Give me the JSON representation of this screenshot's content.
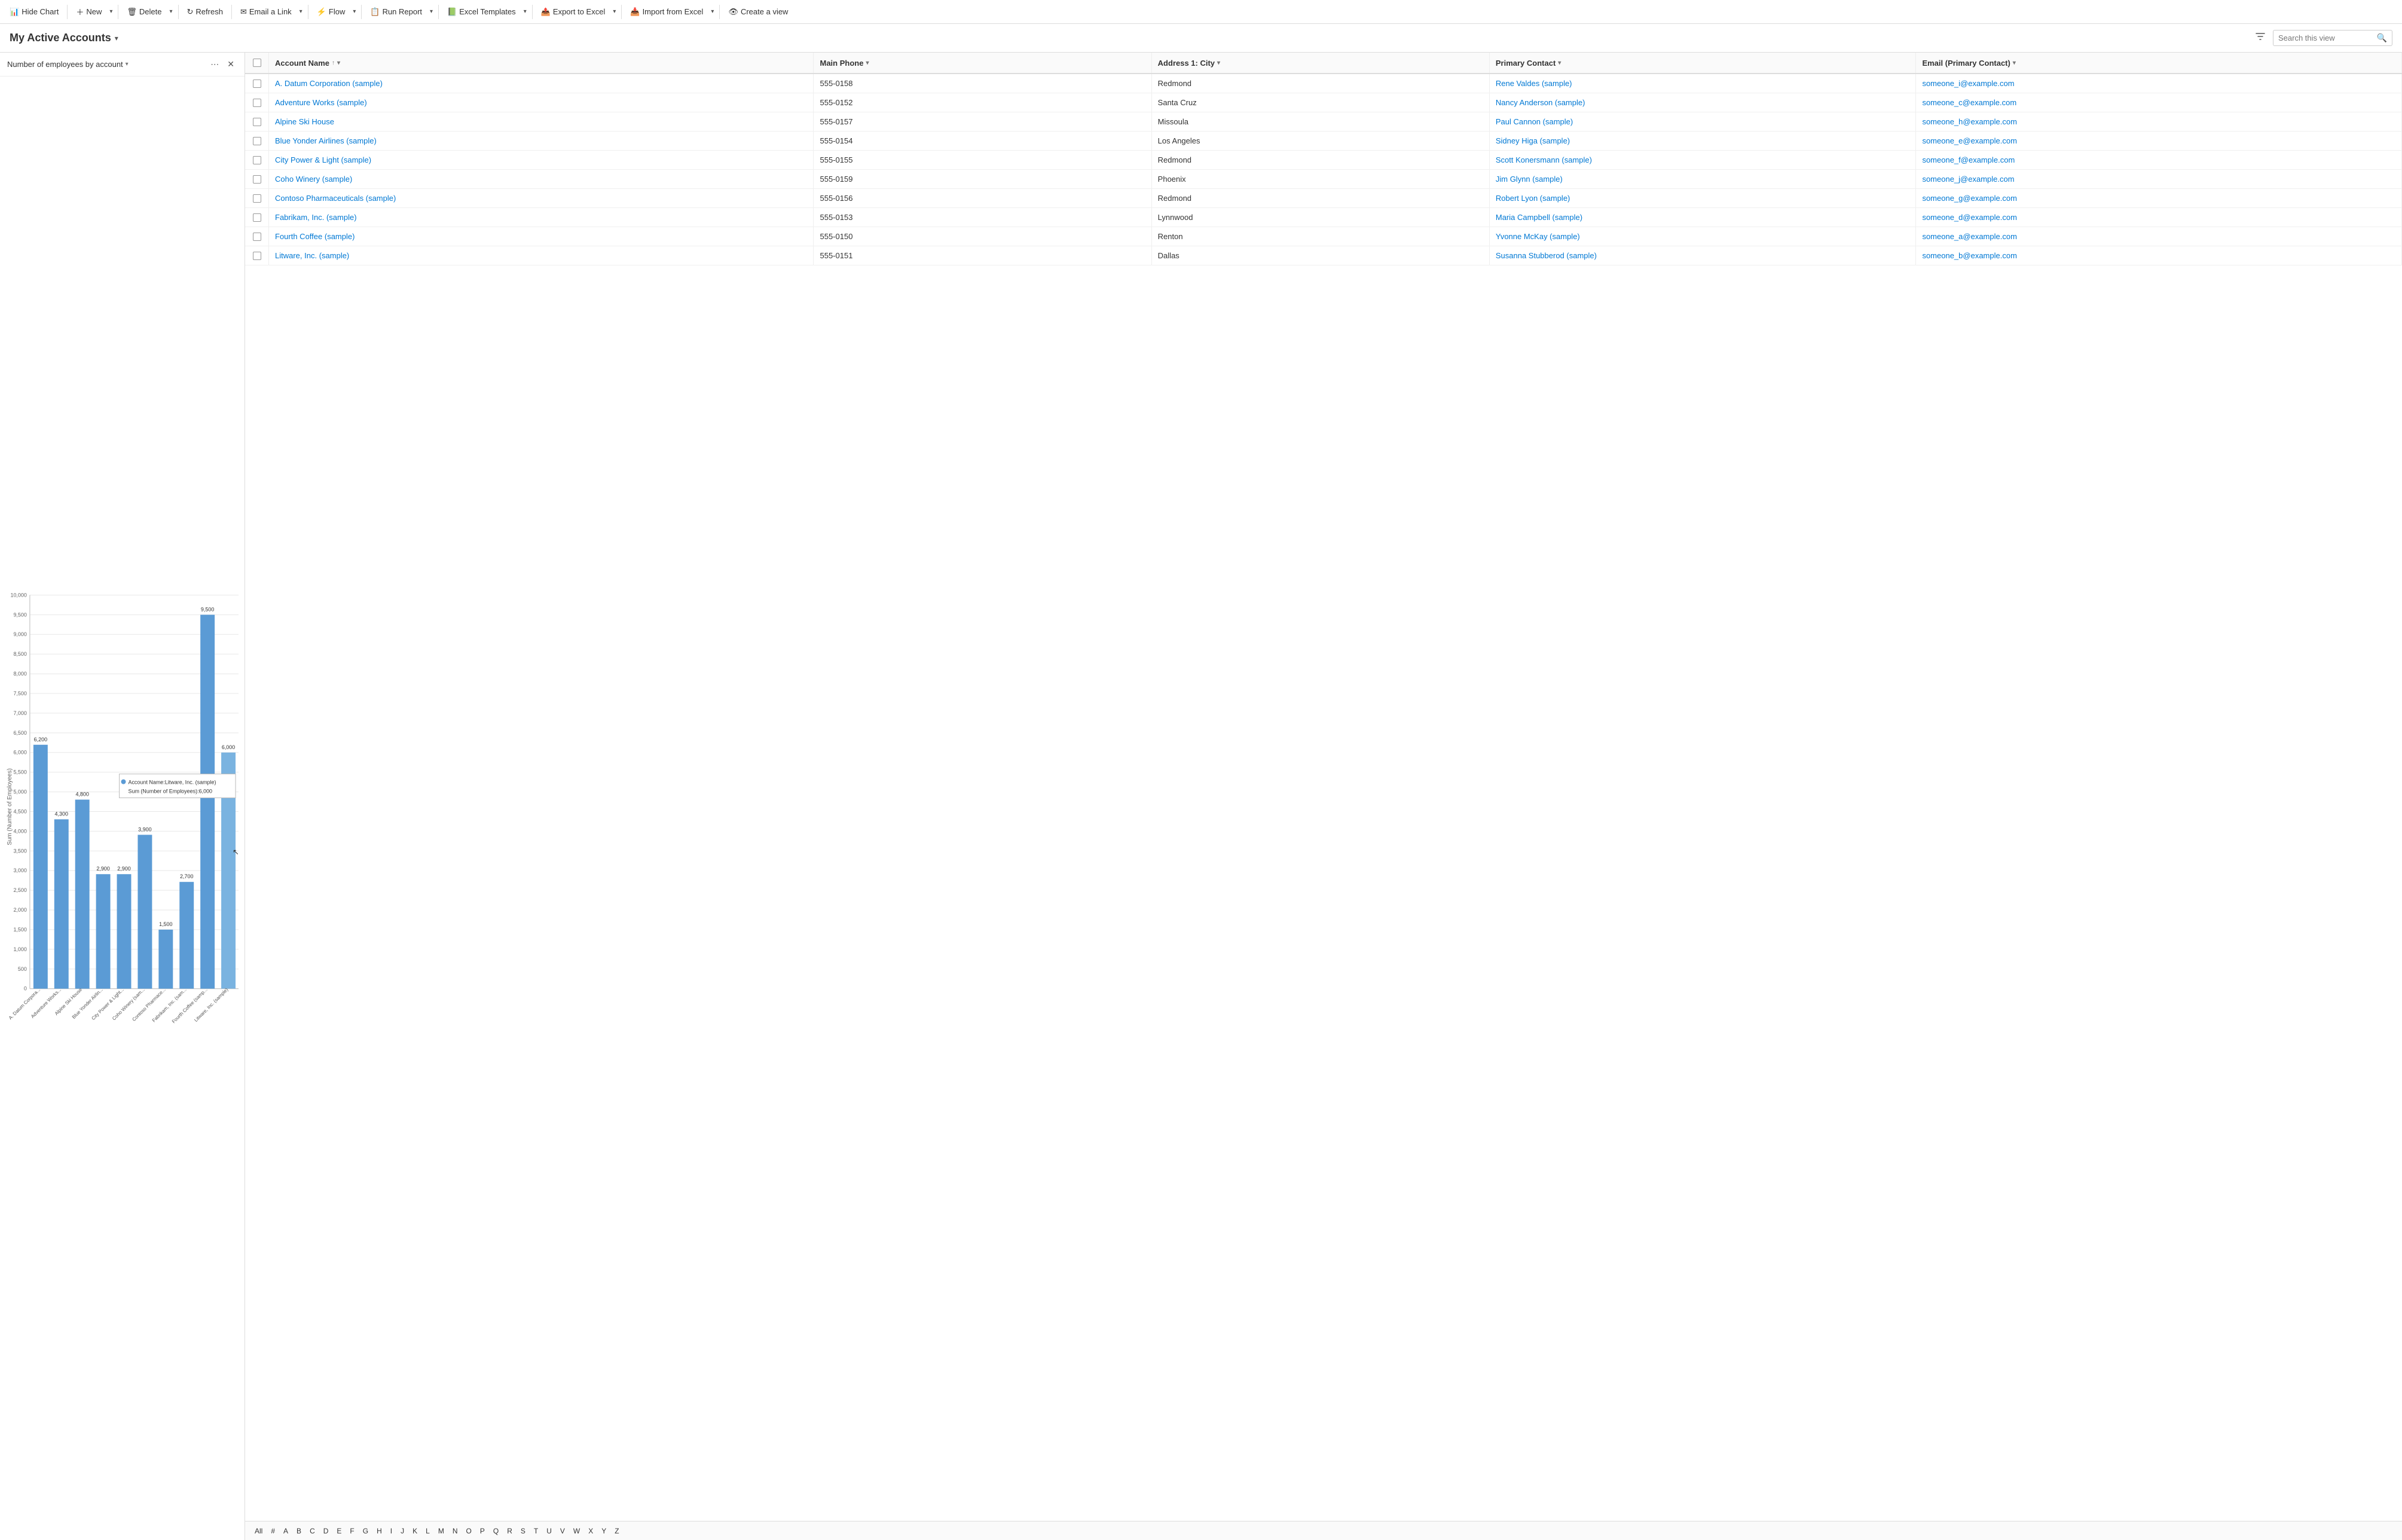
{
  "toolbar": {
    "hide_chart_label": "Hide Chart",
    "new_label": "New",
    "delete_label": "Delete",
    "refresh_label": "Refresh",
    "email_link_label": "Email a Link",
    "flow_label": "Flow",
    "run_report_label": "Run Report",
    "excel_templates_label": "Excel Templates",
    "export_to_excel_label": "Export to Excel",
    "import_from_excel_label": "Import from Excel",
    "create_view_label": "Create a view"
  },
  "page": {
    "title": "My Active Accounts",
    "search_placeholder": "Search this view"
  },
  "chart": {
    "title": "Number of employees by account",
    "more_icon": "⋯",
    "close_icon": "✕",
    "y_axis_label": "Sum (Number of Employees)",
    "bars": [
      {
        "name": "A. Datum Corporation (s...",
        "value": 6200,
        "short": "A. Datum Corpora..."
      },
      {
        "name": "Adventure Works (sample)",
        "value": 4300,
        "short": "Adventure Works..."
      },
      {
        "name": "Alpine Ski House",
        "value": 4800,
        "short": "Alpine Ski House"
      },
      {
        "name": "Blue Yonder Airlines (sample)",
        "value": 2900,
        "short": "Blue Yonder Airlin..."
      },
      {
        "name": "City Power & Light (sample)",
        "value": 2900,
        "short": "City Power & Light..."
      },
      {
        "name": "Coho Winery (sample)",
        "value": 3900,
        "short": "Coho Winery (sam..."
      },
      {
        "name": "Contoso Pharmaceuticals (sample)",
        "value": 1500,
        "short": "Contoso Pharmace..."
      },
      {
        "name": "Fabrikam, Inc. (sample)",
        "value": 2700,
        "short": "Fabrikam, Inc. (sam..."
      },
      {
        "name": "Fourth Coffee (sample)",
        "value": 9500,
        "short": "Fourth Coffee (samp..."
      },
      {
        "name": "Litware, Inc. (sample)",
        "value": 6000,
        "short": "Litware, Inc. (sample)"
      }
    ],
    "tooltip": {
      "visible": true,
      "line1": "Account Name:Litware, Inc. (sample)",
      "line2": "Sum (Number of Employees):6,000"
    }
  },
  "grid": {
    "columns": [
      {
        "id": "account_name",
        "label": "Account Name",
        "sortable": true,
        "filterable": true
      },
      {
        "id": "main_phone",
        "label": "Main Phone",
        "sortable": false,
        "filterable": true
      },
      {
        "id": "address_city",
        "label": "Address 1: City",
        "sortable": false,
        "filterable": true
      },
      {
        "id": "primary_contact",
        "label": "Primary Contact",
        "sortable": false,
        "filterable": true
      },
      {
        "id": "email",
        "label": "Email (Primary Contact)",
        "sortable": false,
        "filterable": true
      }
    ],
    "rows": [
      {
        "account_name": "A. Datum Corporation (sample)",
        "main_phone": "555-0158",
        "address_city": "Redmond",
        "primary_contact": "Rene Valdes (sample)",
        "email": "someone_i@example.com"
      },
      {
        "account_name": "Adventure Works (sample)",
        "main_phone": "555-0152",
        "address_city": "Santa Cruz",
        "primary_contact": "Nancy Anderson (sample)",
        "email": "someone_c@example.com"
      },
      {
        "account_name": "Alpine Ski House",
        "main_phone": "555-0157",
        "address_city": "Missoula",
        "primary_contact": "Paul Cannon (sample)",
        "email": "someone_h@example.com"
      },
      {
        "account_name": "Blue Yonder Airlines (sample)",
        "main_phone": "555-0154",
        "address_city": "Los Angeles",
        "primary_contact": "Sidney Higa (sample)",
        "email": "someone_e@example.com"
      },
      {
        "account_name": "City Power & Light (sample)",
        "main_phone": "555-0155",
        "address_city": "Redmond",
        "primary_contact": "Scott Konersmann (sample)",
        "email": "someone_f@example.com"
      },
      {
        "account_name": "Coho Winery (sample)",
        "main_phone": "555-0159",
        "address_city": "Phoenix",
        "primary_contact": "Jim Glynn (sample)",
        "email": "someone_j@example.com"
      },
      {
        "account_name": "Contoso Pharmaceuticals (sample)",
        "main_phone": "555-0156",
        "address_city": "Redmond",
        "primary_contact": "Robert Lyon (sample)",
        "email": "someone_g@example.com"
      },
      {
        "account_name": "Fabrikam, Inc. (sample)",
        "main_phone": "555-0153",
        "address_city": "Lynnwood",
        "primary_contact": "Maria Campbell (sample)",
        "email": "someone_d@example.com"
      },
      {
        "account_name": "Fourth Coffee (sample)",
        "main_phone": "555-0150",
        "address_city": "Renton",
        "primary_contact": "Yvonne McKay (sample)",
        "email": "someone_a@example.com"
      },
      {
        "account_name": "Litware, Inc. (sample)",
        "main_phone": "555-0151",
        "address_city": "Dallas",
        "primary_contact": "Susanna Stubberod (sample)",
        "email": "someone_b@example.com"
      }
    ]
  },
  "footer": {
    "all_label": "All",
    "pages": [
      "#",
      "A",
      "B",
      "C",
      "D",
      "E",
      "F",
      "G",
      "H",
      "I",
      "J",
      "K",
      "L",
      "M",
      "N",
      "O",
      "P",
      "Q",
      "R",
      "S",
      "T",
      "U",
      "V",
      "W",
      "X",
      "Y",
      "Z"
    ]
  },
  "colors": {
    "bar_fill": "#5b9bd5",
    "bar_hover": "#7ab3e0",
    "link_color": "#0078d4",
    "accent": "#0078d4"
  }
}
